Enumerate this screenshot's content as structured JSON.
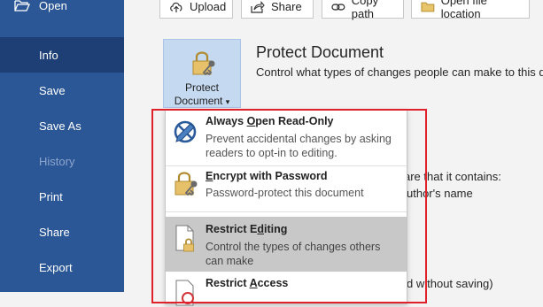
{
  "sidebar": {
    "items": [
      {
        "label": "Open"
      },
      {
        "label": "Info"
      },
      {
        "label": "Save"
      },
      {
        "label": "Save As"
      },
      {
        "label": "History"
      },
      {
        "label": "Print"
      },
      {
        "label": "Share"
      },
      {
        "label": "Export"
      }
    ]
  },
  "toolbar": {
    "upload_label": "Upload",
    "share_label": "Share",
    "copy_path_label": "Copy path",
    "open_location_label": "Open file location"
  },
  "protect": {
    "tile_line1": "Protect",
    "tile_line2": "Document",
    "tile_caret": "▾",
    "title": "Protect Document",
    "description": "Control what types of changes people can make to this docu"
  },
  "background_text": {
    "line1": "are that it contains:",
    "line2": "uthor's name",
    "line3": "d without saving)"
  },
  "menu": {
    "items": [
      {
        "title_pre": "Always ",
        "title_ul": "O",
        "title_post": "pen Read-Only",
        "desc": "Prevent accidental changes by asking readers to opt-in to editing."
      },
      {
        "title_pre": "",
        "title_ul": "E",
        "title_post": "ncrypt with Password",
        "desc": "Password-protect this document"
      },
      {
        "title_pre": "Restrict E",
        "title_ul": "d",
        "title_post": "iting",
        "desc": "Control the types of changes others can make"
      },
      {
        "title_pre": "Restrict ",
        "title_ul": "A",
        "title_post": "ccess",
        "desc": ""
      }
    ]
  },
  "colors": {
    "sidebar": "#2b5797",
    "sidebar_selected": "#1e3f75",
    "tile": "#c5d9f1",
    "highlight": "#c8c8c8",
    "annotation": "#e0202a"
  }
}
